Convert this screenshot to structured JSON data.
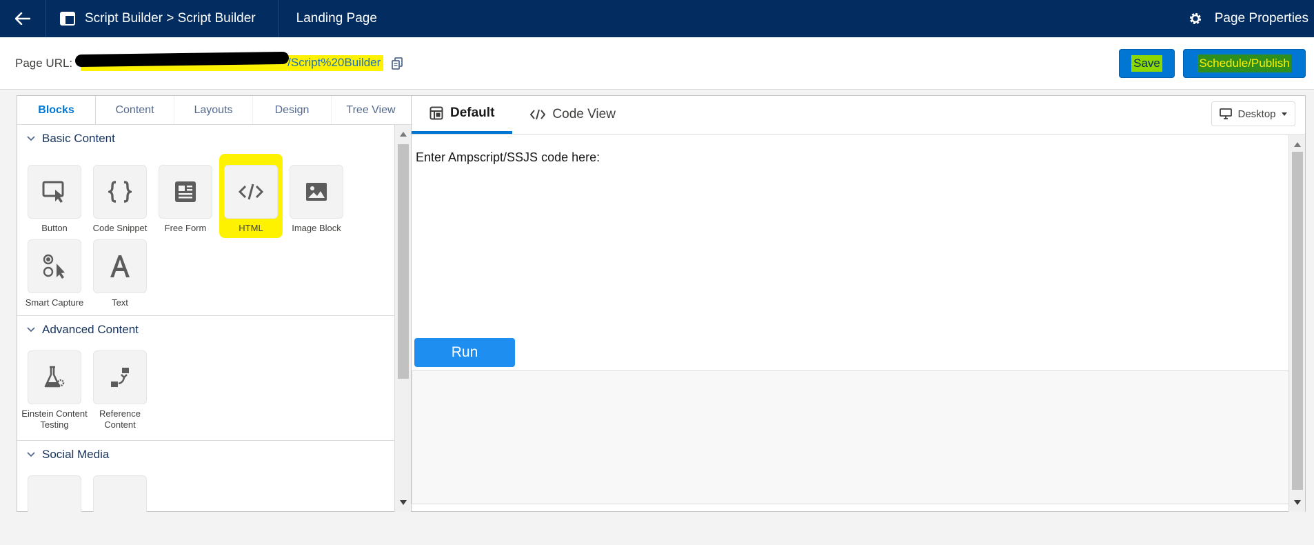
{
  "nav": {
    "breadcrumb": "Script Builder > Script Builder",
    "page_name": "Landing Page",
    "properties_label": "Page Properties"
  },
  "urlbar": {
    "label": "Page URL:",
    "url_visible": "/Script%20Builder",
    "save_label": "Save",
    "publish_label": "Schedule/Publish"
  },
  "left": {
    "tabs": [
      "Blocks",
      "Content",
      "Layouts",
      "Design",
      "Tree View"
    ],
    "basic_title": "Basic Content",
    "basic_blocks": [
      "Button",
      "Code Snippet",
      "Free Form",
      "HTML",
      "Image Block",
      "Smart Capture",
      "Text"
    ],
    "advanced_title": "Advanced Content",
    "advanced_blocks": [
      "Einstein Content Testing",
      "Reference Content"
    ],
    "social_title": "Social Media"
  },
  "editor": {
    "tab_default": "Default",
    "tab_code": "Code View",
    "device": "Desktop",
    "prompt": "Enter Ampscript/SSJS code here:",
    "run_label": "Run"
  },
  "colors": {
    "nav_bg": "#032d60",
    "brand_blue": "#0176d3",
    "highlight_yellow": "#fff200",
    "highlight_green": "#8cd800"
  }
}
